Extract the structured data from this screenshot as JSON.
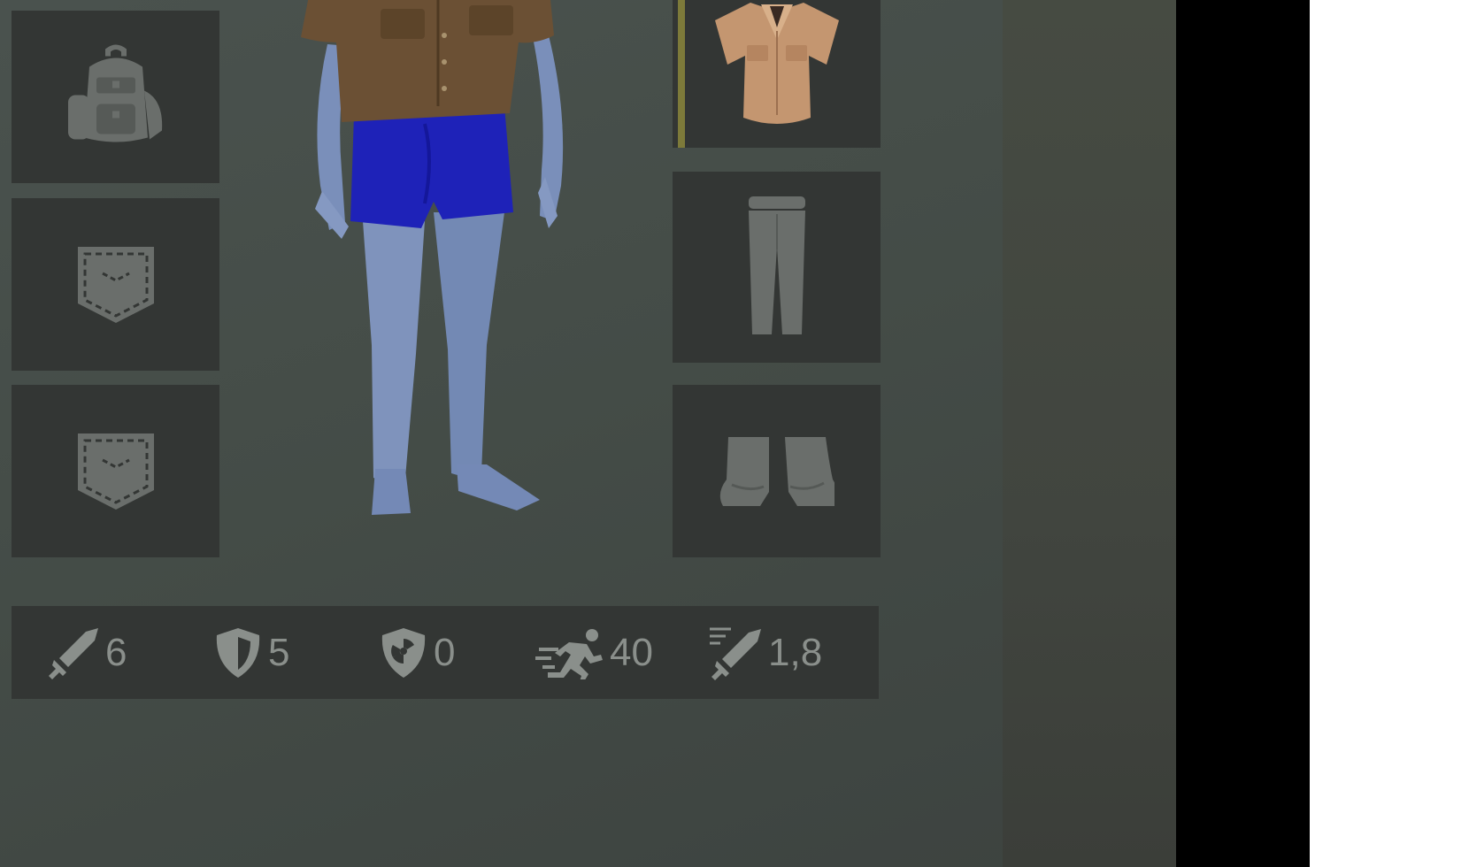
{
  "slots": {
    "left": [
      {
        "id": "backpack",
        "icon": "backpack-icon",
        "equipped": false
      },
      {
        "id": "pocket-1",
        "icon": "pocket-icon",
        "equipped": false
      },
      {
        "id": "pocket-2",
        "icon": "pocket-icon",
        "equipped": false
      }
    ],
    "right": [
      {
        "id": "torso",
        "icon": "shirt-icon",
        "equipped": true
      },
      {
        "id": "legs",
        "icon": "pants-icon",
        "equipped": false
      },
      {
        "id": "feet",
        "icon": "boots-icon",
        "equipped": false
      }
    ]
  },
  "stats": {
    "attack": "6",
    "armor": "5",
    "radiation": "0",
    "speed": "40",
    "attack_speed": "1,8"
  },
  "colors": {
    "slot_bg": "#333634",
    "equipped_accent": "#7d7a3a",
    "stat_text": "#8a8f8b",
    "pants": "#1e22b8",
    "skin": "#7e93bd",
    "shirt": "#6b5034"
  }
}
